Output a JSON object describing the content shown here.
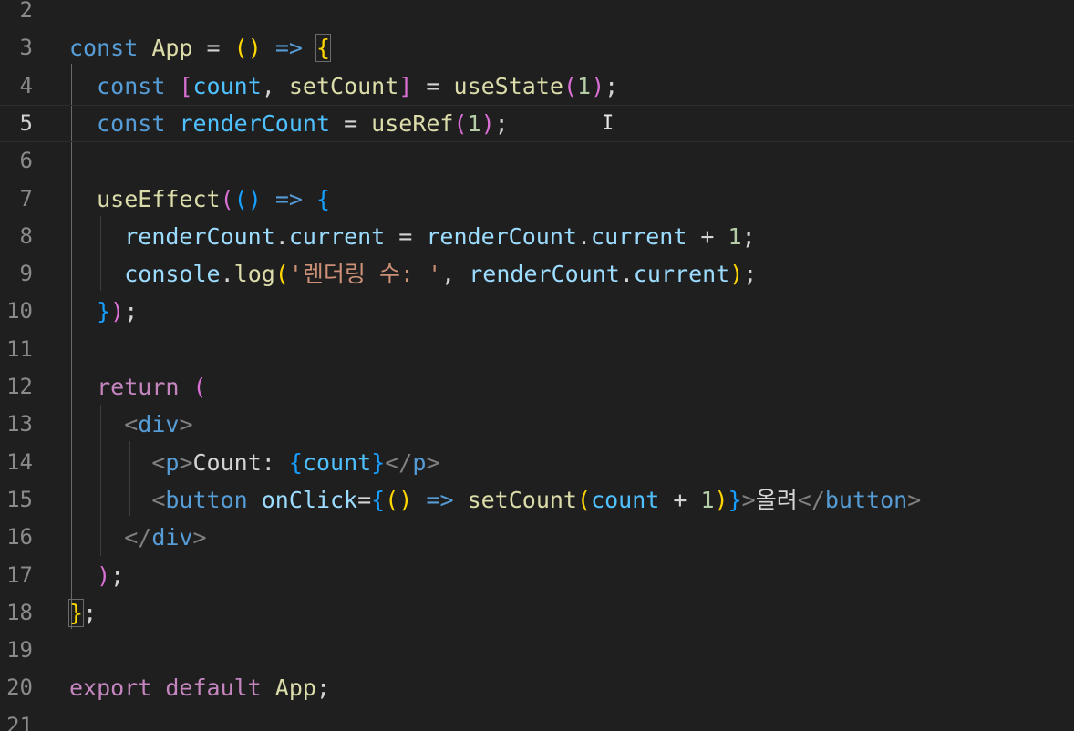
{
  "editor": {
    "cursor_glyph": "I",
    "lines": [
      {
        "num": "2",
        "tokens": []
      },
      {
        "num": "3",
        "tokens": [
          {
            "t": "const",
            "c": "kw"
          },
          {
            "t": " ",
            "c": "plain"
          },
          {
            "t": "App",
            "c": "fn"
          },
          {
            "t": " = ",
            "c": "op"
          },
          {
            "t": "()",
            "c": "b1"
          },
          {
            "t": " ",
            "c": "plain"
          },
          {
            "t": "=>",
            "c": "kw"
          },
          {
            "t": " ",
            "c": "plain"
          },
          {
            "t": "{",
            "c": "b1",
            "m": true
          }
        ]
      },
      {
        "num": "4",
        "tokens": [
          {
            "t": "  ",
            "c": "plain"
          },
          {
            "t": "const",
            "c": "kw"
          },
          {
            "t": " ",
            "c": "plain"
          },
          {
            "t": "[",
            "c": "b2"
          },
          {
            "t": "count",
            "c": "const"
          },
          {
            "t": ", ",
            "c": "plain"
          },
          {
            "t": "setCount",
            "c": "fn"
          },
          {
            "t": "]",
            "c": "b2"
          },
          {
            "t": " = ",
            "c": "op"
          },
          {
            "t": "useState",
            "c": "fn"
          },
          {
            "t": "(",
            "c": "b2"
          },
          {
            "t": "1",
            "c": "num"
          },
          {
            "t": ")",
            "c": "b2"
          },
          {
            "t": ";",
            "c": "plain"
          }
        ]
      },
      {
        "num": "5",
        "active": true,
        "tokens": [
          {
            "t": "  ",
            "c": "plain"
          },
          {
            "t": "const",
            "c": "kw"
          },
          {
            "t": " ",
            "c": "plain"
          },
          {
            "t": "renderCount",
            "c": "const"
          },
          {
            "t": " = ",
            "c": "op"
          },
          {
            "t": "useRef",
            "c": "fn"
          },
          {
            "t": "(",
            "c": "b2"
          },
          {
            "t": "1",
            "c": "num"
          },
          {
            "t": ")",
            "c": "b2"
          },
          {
            "t": ";",
            "c": "plain"
          }
        ]
      },
      {
        "num": "6",
        "tokens": []
      },
      {
        "num": "7",
        "tokens": [
          {
            "t": "  ",
            "c": "plain"
          },
          {
            "t": "useEffect",
            "c": "fn"
          },
          {
            "t": "(",
            "c": "b2"
          },
          {
            "t": "()",
            "c": "b3"
          },
          {
            "t": " ",
            "c": "plain"
          },
          {
            "t": "=>",
            "c": "kw"
          },
          {
            "t": " ",
            "c": "plain"
          },
          {
            "t": "{",
            "c": "b3"
          }
        ]
      },
      {
        "num": "8",
        "tokens": [
          {
            "t": "    ",
            "c": "plain"
          },
          {
            "t": "renderCount",
            "c": "var"
          },
          {
            "t": ".",
            "c": "plain"
          },
          {
            "t": "current",
            "c": "var"
          },
          {
            "t": " = ",
            "c": "op"
          },
          {
            "t": "renderCount",
            "c": "var"
          },
          {
            "t": ".",
            "c": "plain"
          },
          {
            "t": "current",
            "c": "var"
          },
          {
            "t": " + ",
            "c": "op"
          },
          {
            "t": "1",
            "c": "num"
          },
          {
            "t": ";",
            "c": "plain"
          }
        ]
      },
      {
        "num": "9",
        "tokens": [
          {
            "t": "    ",
            "c": "plain"
          },
          {
            "t": "console",
            "c": "var"
          },
          {
            "t": ".",
            "c": "plain"
          },
          {
            "t": "log",
            "c": "fn"
          },
          {
            "t": "(",
            "c": "b1"
          },
          {
            "t": "'렌더링 수: '",
            "c": "str"
          },
          {
            "t": ", ",
            "c": "plain"
          },
          {
            "t": "renderCount",
            "c": "var"
          },
          {
            "t": ".",
            "c": "plain"
          },
          {
            "t": "current",
            "c": "var"
          },
          {
            "t": ")",
            "c": "b1"
          },
          {
            "t": ";",
            "c": "plain"
          }
        ]
      },
      {
        "num": "10",
        "tokens": [
          {
            "t": "  ",
            "c": "plain"
          },
          {
            "t": "}",
            "c": "b3"
          },
          {
            "t": ")",
            "c": "b2"
          },
          {
            "t": ";",
            "c": "plain"
          }
        ]
      },
      {
        "num": "11",
        "tokens": []
      },
      {
        "num": "12",
        "tokens": [
          {
            "t": "  ",
            "c": "plain"
          },
          {
            "t": "return",
            "c": "ctrl"
          },
          {
            "t": " ",
            "c": "plain"
          },
          {
            "t": "(",
            "c": "b2"
          }
        ]
      },
      {
        "num": "13",
        "tokens": [
          {
            "t": "    ",
            "c": "plain"
          },
          {
            "t": "<",
            "c": "tagp"
          },
          {
            "t": "div",
            "c": "tag"
          },
          {
            "t": ">",
            "c": "tagp"
          }
        ]
      },
      {
        "num": "14",
        "tokens": [
          {
            "t": "      ",
            "c": "plain"
          },
          {
            "t": "<",
            "c": "tagp"
          },
          {
            "t": "p",
            "c": "tag"
          },
          {
            "t": ">",
            "c": "tagp"
          },
          {
            "t": "Count: ",
            "c": "plain"
          },
          {
            "t": "{",
            "c": "b3"
          },
          {
            "t": "count",
            "c": "const"
          },
          {
            "t": "}",
            "c": "b3"
          },
          {
            "t": "</",
            "c": "tagp"
          },
          {
            "t": "p",
            "c": "tag"
          },
          {
            "t": ">",
            "c": "tagp"
          }
        ]
      },
      {
        "num": "15",
        "tokens": [
          {
            "t": "      ",
            "c": "plain"
          },
          {
            "t": "<",
            "c": "tagp"
          },
          {
            "t": "button",
            "c": "tag"
          },
          {
            "t": " ",
            "c": "plain"
          },
          {
            "t": "onClick",
            "c": "attr"
          },
          {
            "t": "=",
            "c": "op"
          },
          {
            "t": "{",
            "c": "b3"
          },
          {
            "t": "()",
            "c": "b1"
          },
          {
            "t": " ",
            "c": "plain"
          },
          {
            "t": "=>",
            "c": "kw"
          },
          {
            "t": " ",
            "c": "plain"
          },
          {
            "t": "setCount",
            "c": "fn"
          },
          {
            "t": "(",
            "c": "b1"
          },
          {
            "t": "count",
            "c": "const"
          },
          {
            "t": " + ",
            "c": "op"
          },
          {
            "t": "1",
            "c": "num"
          },
          {
            "t": ")",
            "c": "b1"
          },
          {
            "t": "}",
            "c": "b3"
          },
          {
            "t": ">",
            "c": "tagp"
          },
          {
            "t": "올려",
            "c": "plain"
          },
          {
            "t": "</",
            "c": "tagp"
          },
          {
            "t": "button",
            "c": "tag"
          },
          {
            "t": ">",
            "c": "tagp"
          }
        ]
      },
      {
        "num": "16",
        "tokens": [
          {
            "t": "    ",
            "c": "plain"
          },
          {
            "t": "</",
            "c": "tagp"
          },
          {
            "t": "div",
            "c": "tag"
          },
          {
            "t": ">",
            "c": "tagp"
          }
        ]
      },
      {
        "num": "17",
        "tokens": [
          {
            "t": "  ",
            "c": "plain"
          },
          {
            "t": ")",
            "c": "b2"
          },
          {
            "t": ";",
            "c": "plain"
          }
        ]
      },
      {
        "num": "18",
        "tokens": [
          {
            "t": "}",
            "c": "b1",
            "m": true
          },
          {
            "t": ";",
            "c": "plain"
          }
        ]
      },
      {
        "num": "19",
        "tokens": []
      },
      {
        "num": "20",
        "tokens": [
          {
            "t": "export",
            "c": "ctrl"
          },
          {
            "t": " ",
            "c": "plain"
          },
          {
            "t": "default",
            "c": "ctrl"
          },
          {
            "t": " ",
            "c": "plain"
          },
          {
            "t": "App",
            "c": "fn"
          },
          {
            "t": ";",
            "c": "plain"
          }
        ]
      },
      {
        "num": "21",
        "tokens": []
      }
    ]
  }
}
